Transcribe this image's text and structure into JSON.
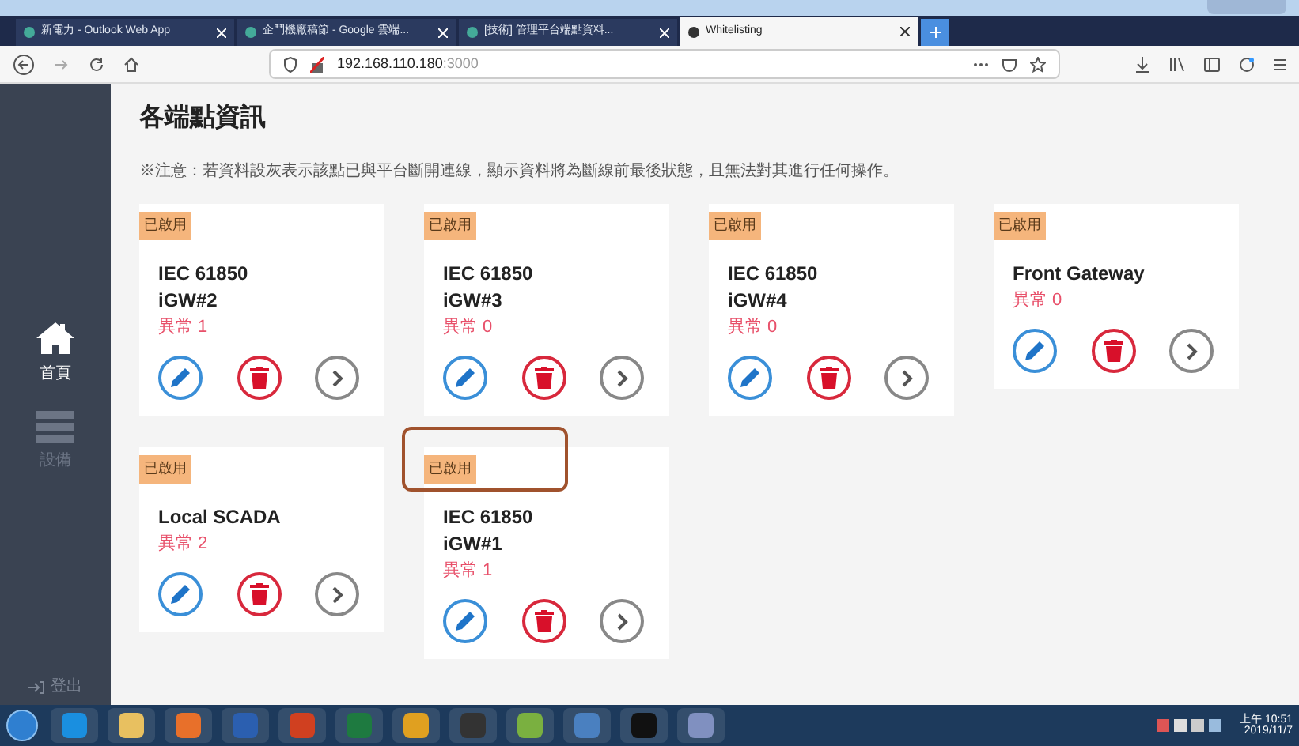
{
  "browser": {
    "tabs": [
      {
        "label": "新電力 - Outlook Web App",
        "selected": false
      },
      {
        "label": "企鬥機廠稿節 - Google 雲端...",
        "selected": false
      },
      {
        "label": "[技術] 管理平台端點資料...",
        "selected": false
      },
      {
        "label": "Whitelisting",
        "selected": true
      }
    ],
    "url": "192.168.110.180",
    "url_port": ":3000"
  },
  "sidebar": {
    "items": [
      {
        "kind": "home",
        "label": "首頁",
        "selected": true
      },
      {
        "kind": "list",
        "label": "設備",
        "selected": false
      }
    ],
    "logout": "登出"
  },
  "page": {
    "title": "各端點資訊",
    "note": "※注意：若資料設灰表示該點已與平台斷開連線，顯示資料將為斷線前最後狀態，且無法對其進行任何操作。"
  },
  "cards": [
    {
      "badge": "已啟用",
      "name_lines": [
        "IEC 61850",
        "iGW#2"
      ],
      "status": "異常 1",
      "highlighted": false
    },
    {
      "badge": "已啟用",
      "name_lines": [
        "IEC 61850",
        "iGW#3"
      ],
      "status": "異常 0",
      "highlighted": false
    },
    {
      "badge": "已啟用",
      "name_lines": [
        "IEC 61850",
        "iGW#4"
      ],
      "status": "異常 0",
      "highlighted": false
    },
    {
      "badge": "已啟用",
      "name_lines": [
        "Front Gateway"
      ],
      "status": "異常 0",
      "highlighted": false
    },
    {
      "badge": "已啟用",
      "name_lines": [
        "Local SCADA"
      ],
      "status": "異常 2",
      "highlighted": false
    },
    {
      "badge": "已啟用",
      "name_lines": [
        "IEC 61850",
        "iGW#1"
      ],
      "status": "異常 1",
      "highlighted": true
    }
  ],
  "taskbar": {
    "time": "上午 10:51",
    "date": "2019/11/7"
  }
}
